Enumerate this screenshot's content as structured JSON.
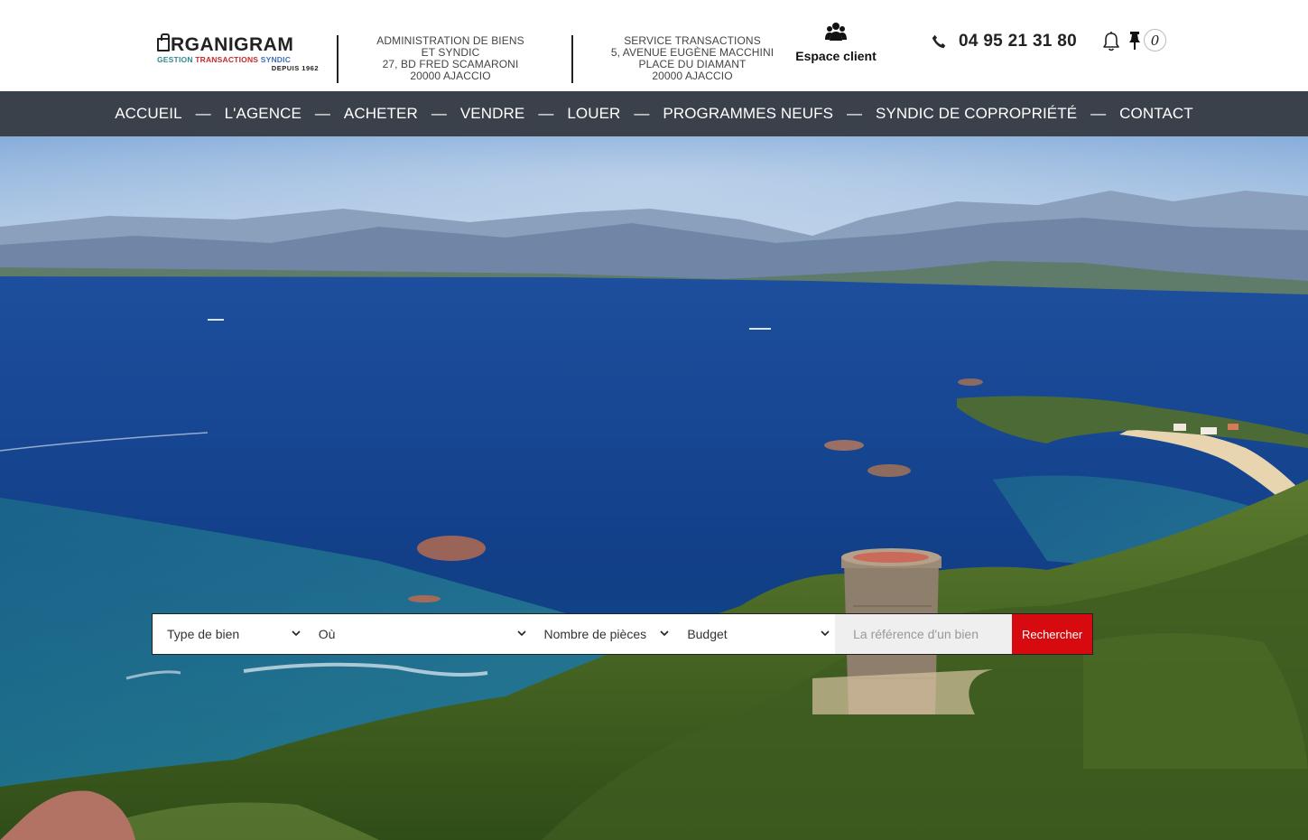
{
  "header": {
    "logo": {
      "main": "RGANIGRAM",
      "sub_1": "GESTION",
      "sub_2": "TRANSACTIONS",
      "sub_3": "SYNDIC",
      "since": "DEPUIS 1962"
    },
    "address_1": [
      "ADMINISTRATION DE BIENS",
      "ET SYNDIC",
      "27, BD FRED SCAMARONI",
      "20000 AJACCIO"
    ],
    "address_2": [
      "SERVICE TRANSACTIONS",
      "5, AVENUE EUGÈNE MACCHINI",
      "PLACE DU DIAMANT",
      "20000 AJACCIO"
    ],
    "espace_client": {
      "label": "Espace client",
      "icon": "users-icon"
    },
    "phone": {
      "number": "04 95 21 31 80",
      "icon": "phone-icon"
    },
    "notifications": {
      "icon": "bell-icon"
    },
    "selection": {
      "icon": "pin-icon",
      "count": "0"
    }
  },
  "nav": {
    "items": [
      "ACCUEIL",
      "L'AGENCE",
      "ACHETER",
      "VENDRE",
      "LOUER",
      "PROGRAMMES NEUFS",
      "SYNDIC DE COPROPRIÉTÉ",
      "CONTACT"
    ],
    "separator": "—",
    "background": "#3b414a"
  },
  "search": {
    "type_de_bien": "Type de bien",
    "ou": "Où",
    "nombre_de_pieces": "Nombre de pièces",
    "budget": "Budget",
    "reference_placeholder": "La référence d'un bien",
    "submit_label": "Rechercher",
    "submit_color": "#d60a0f"
  },
  "colors": {
    "accent": "#d60a0f",
    "nav": "#3b414a"
  }
}
